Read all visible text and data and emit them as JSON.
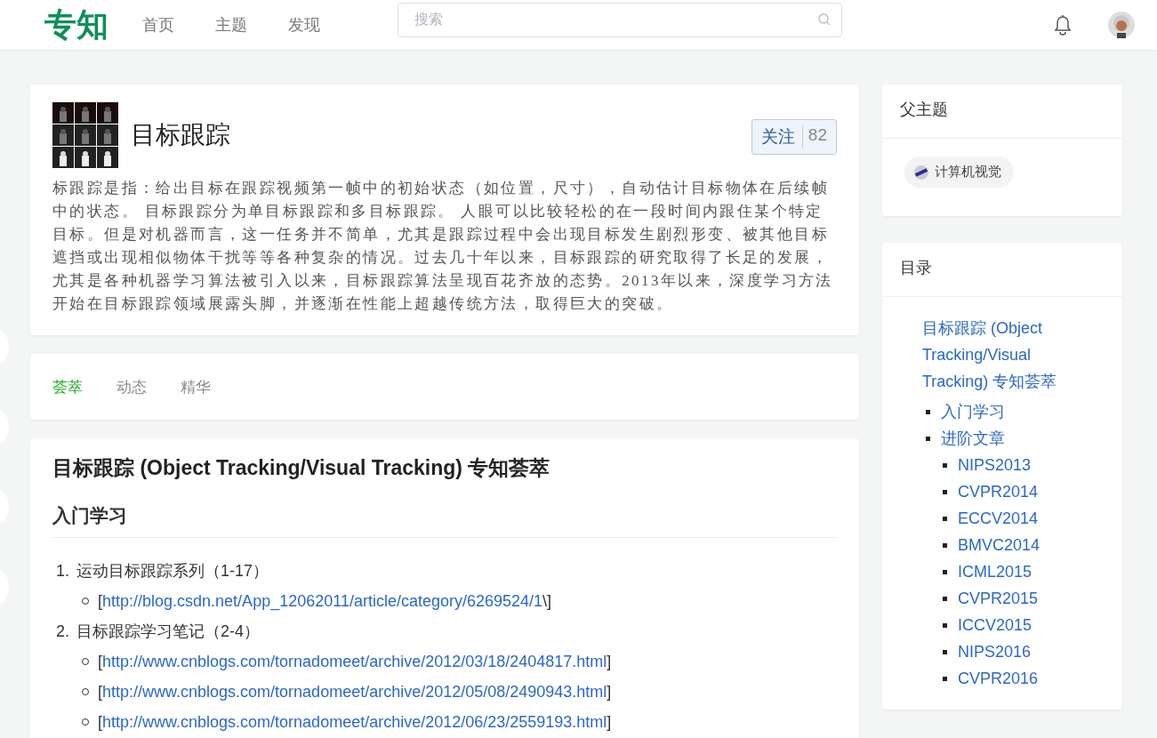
{
  "header": {
    "logo": "专知",
    "nav": [
      {
        "label": "首页"
      },
      {
        "label": "主题"
      },
      {
        "label": "发现"
      }
    ],
    "search": {
      "placeholder": "搜索"
    }
  },
  "topic": {
    "title": "目标跟踪",
    "follow": {
      "label": "关注",
      "count": "82"
    },
    "description": "标跟踪是指：给出目标在跟踪视频第一帧中的初始状态（如位置，尺寸），自动估计目标物体在后续帧中的状态。 目标跟踪分为单目标跟踪和多目标跟踪。 人眼可以比较轻松的在一段时间内跟住某个特定目标。但是对机器而言，这一任务并不简单，尤其是跟踪过程中会出现目标发生剧烈形变、被其他目标遮挡或出现相似物体干扰等等各种复杂的情况。过去几十年以来，目标跟踪的研究取得了长足的发展，尤其是各种机器学习算法被引入以来，目标跟踪算法呈现百花齐放的态势。2013年以来，深度学习方法开始在目标跟踪领域展露头脚，并逐渐在性能上超越传统方法，取得巨大的突破。"
  },
  "tabs": [
    {
      "label": "荟萃",
      "selected": true
    },
    {
      "label": "动态",
      "selected": false
    },
    {
      "label": "精华",
      "selected": false
    }
  ],
  "article": {
    "title": "目标跟踪 (Object Tracking/Visual Tracking) 专知荟萃",
    "section_heading": "入门学习",
    "items": [
      {
        "number": "1.",
        "text": "运动目标跟踪系列（1-17）",
        "links": [
          {
            "open": "[",
            "url": "http://blog.csdn.net/App_12062011/article/category/6269524/1",
            "close": "\\]"
          }
        ]
      },
      {
        "number": "2.",
        "text": "目标跟踪学习笔记（2-4）",
        "links": [
          {
            "open": "[",
            "url": "http://www.cnblogs.com/tornadomeet/archive/2012/03/18/2404817.html",
            "close": "]"
          },
          {
            "open": "[",
            "url": "http://www.cnblogs.com/tornadomeet/archive/2012/05/08/2490943.html",
            "close": "]"
          },
          {
            "open": "[",
            "url": "http://www.cnblogs.com/tornadomeet/archive/2012/06/23/2559193.html",
            "close": "]"
          }
        ]
      }
    ]
  },
  "parent_topic": {
    "heading": "父主题",
    "tags": [
      {
        "label": "计算机视觉"
      }
    ]
  },
  "toc": {
    "heading": "目录",
    "title_link": "目标跟踪 (Object Tracking/Visual Tracking) 专知荟萃",
    "entries": [
      {
        "label": "入门学习"
      },
      {
        "label": "进阶文章",
        "children": [
          {
            "label": "NIPS2013"
          },
          {
            "label": "CVPR2014"
          },
          {
            "label": "ECCV2014"
          },
          {
            "label": "BMVC2014"
          },
          {
            "label": "ICML2015"
          },
          {
            "label": "CVPR2015"
          },
          {
            "label": "ICCV2015"
          },
          {
            "label": "NIPS2016"
          },
          {
            "label": "CVPR2016"
          }
        ]
      }
    ]
  }
}
